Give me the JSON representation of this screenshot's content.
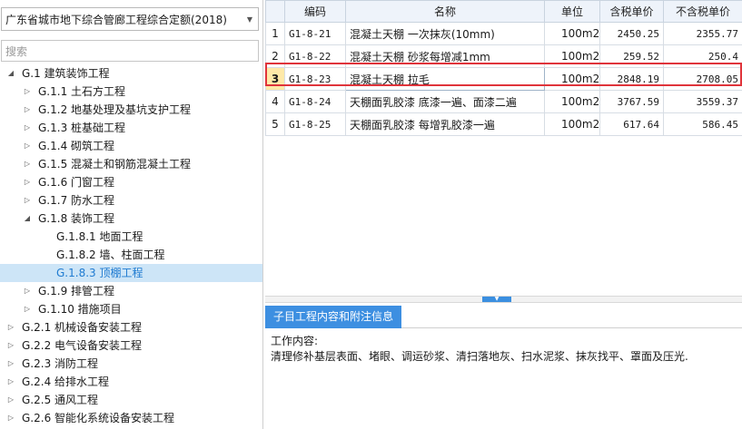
{
  "quota_select": {
    "value": "广东省城市地下综合管廊工程综合定额(2018)"
  },
  "search": {
    "placeholder": "搜索"
  },
  "tree": [
    {
      "label": "G.1 建筑装饰工程",
      "level": 0,
      "expanded": true
    },
    {
      "label": "G.1.1 土石方工程",
      "level": 1,
      "expanded": false
    },
    {
      "label": "G.1.2 地基处理及基坑支护工程",
      "level": 1,
      "expanded": false
    },
    {
      "label": "G.1.3 桩基础工程",
      "level": 1,
      "expanded": false
    },
    {
      "label": "G.1.4 砌筑工程",
      "level": 1,
      "expanded": false
    },
    {
      "label": "G.1.5 混凝土和钢筋混凝土工程",
      "level": 1,
      "expanded": false
    },
    {
      "label": "G.1.6 门窗工程",
      "level": 1,
      "expanded": false
    },
    {
      "label": "G.1.7 防水工程",
      "level": 1,
      "expanded": false
    },
    {
      "label": "G.1.8 装饰工程",
      "level": 1,
      "expanded": true
    },
    {
      "label": "G.1.8.1 地面工程",
      "level": 2,
      "leaf": true
    },
    {
      "label": "G.1.8.2 墙、柱面工程",
      "level": 2,
      "leaf": true
    },
    {
      "label": "G.1.8.3 顶棚工程",
      "level": 2,
      "leaf": true,
      "selected": true
    },
    {
      "label": "G.1.9 排管工程",
      "level": 1,
      "expanded": false
    },
    {
      "label": "G.1.10 措施项目",
      "level": 1,
      "expanded": false
    },
    {
      "label": "G.2.1 机械设备安装工程",
      "level": 0,
      "expanded": false
    },
    {
      "label": "G.2.2 电气设备安装工程",
      "level": 0,
      "expanded": false
    },
    {
      "label": "G.2.3 消防工程",
      "level": 0,
      "expanded": false
    },
    {
      "label": "G.2.4 给排水工程",
      "level": 0,
      "expanded": false
    },
    {
      "label": "G.2.5 通风工程",
      "level": 0,
      "expanded": false
    },
    {
      "label": "G.2.6 智能化系统设备安装工程",
      "level": 0,
      "expanded": false
    }
  ],
  "grid": {
    "headers": {
      "code": "编码",
      "name": "名称",
      "unit": "单位",
      "price_tax": "含税单价",
      "price_notax": "不含税单价"
    },
    "rows": [
      {
        "no": "1",
        "code": "G1-8-21",
        "name": "混凝土天棚 一次抹灰(10mm)",
        "unit": "100m2",
        "price_tax": "2450.25",
        "price_notax": "2355.77"
      },
      {
        "no": "2",
        "code": "G1-8-22",
        "name": "混凝土天棚 砂浆每增减1mm",
        "unit": "100m2",
        "price_tax": "259.52",
        "price_notax": "250.4"
      },
      {
        "no": "3",
        "code": "G1-8-23",
        "name": "混凝土天棚 拉毛",
        "unit": "100m2",
        "price_tax": "2848.19",
        "price_notax": "2708.05",
        "selected": true
      },
      {
        "no": "4",
        "code": "G1-8-24",
        "name": "天棚面乳胶漆 底漆一遍、面漆二遍",
        "unit": "100m2",
        "price_tax": "3767.59",
        "price_notax": "3559.37"
      },
      {
        "no": "5",
        "code": "G1-8-25",
        "name": "天棚面乳胶漆 每增乳胶漆一遍",
        "unit": "100m2",
        "price_tax": "617.64",
        "price_notax": "586.45"
      }
    ]
  },
  "detail": {
    "tab_label": "子目工程内容和附注信息",
    "heading": "工作内容:",
    "content": "清理修补基层表面、堵眼、调运砂浆、清扫落地灰、扫水泥浆、抹灰找平、罩面及压光."
  },
  "colors": {
    "accent": "#3d8fe1",
    "selection_outline": "#e0343b",
    "tree_selected_bg": "#cde5f7"
  }
}
